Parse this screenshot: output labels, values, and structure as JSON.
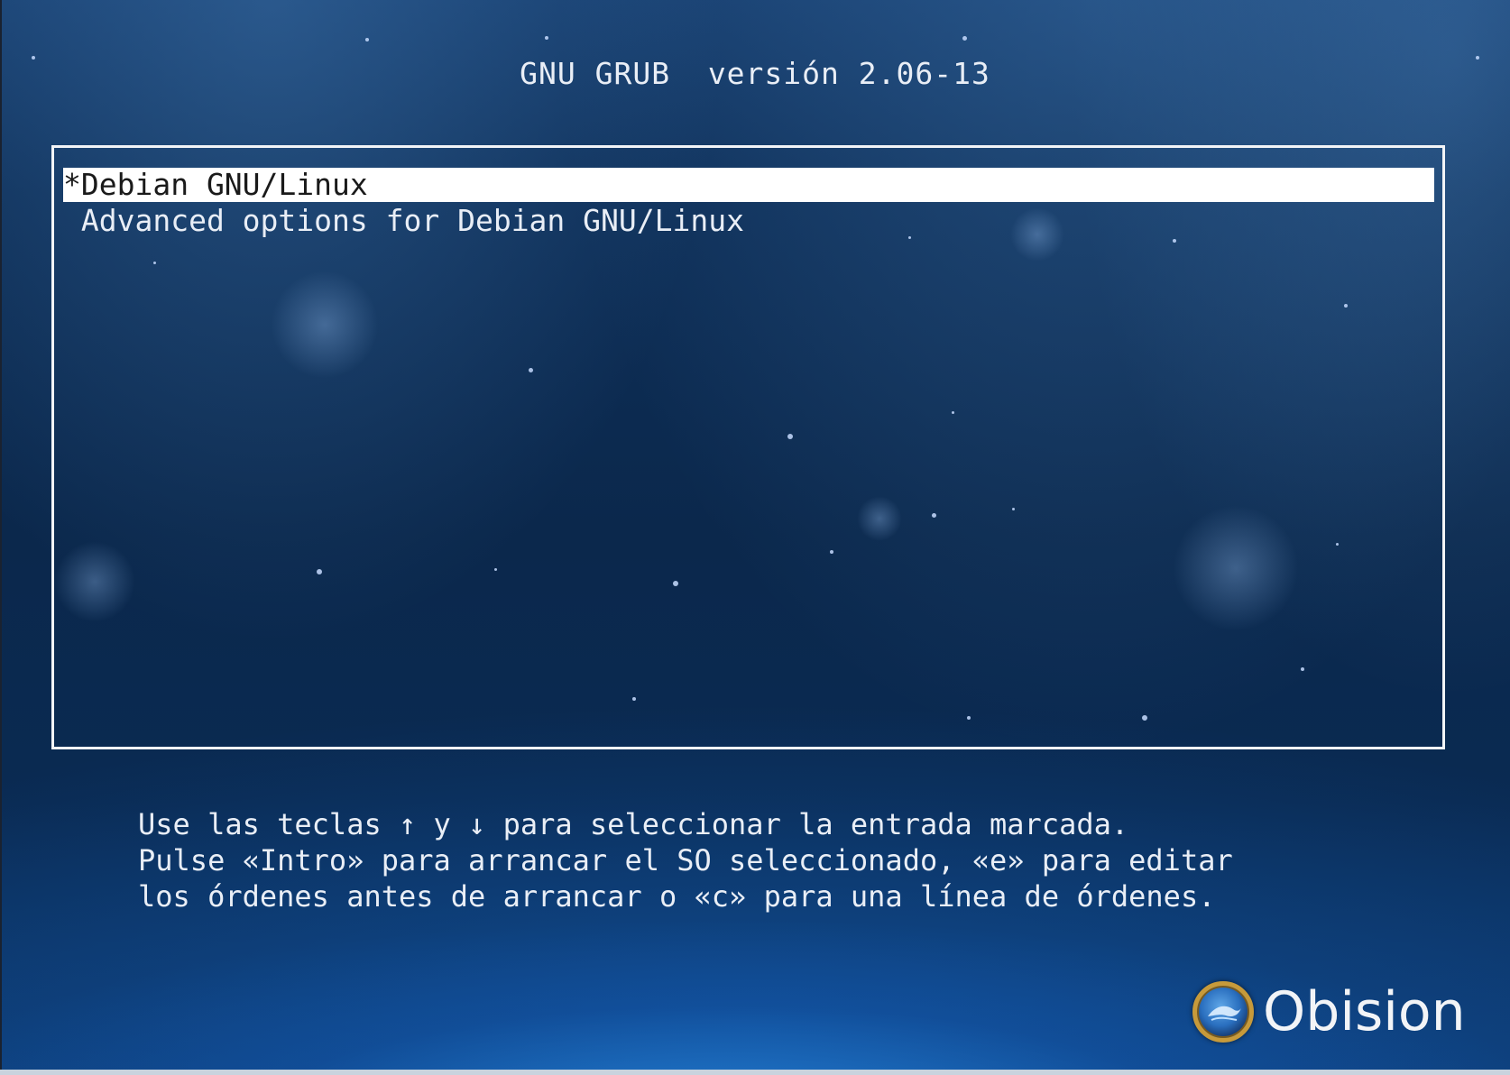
{
  "header": {
    "title": "GNU GRUB  versión 2.06-13"
  },
  "menu": {
    "entries": [
      {
        "label": "*Debian GNU/Linux",
        "selected": true
      },
      {
        "label": " Advanced options for Debian GNU/Linux",
        "selected": false
      }
    ]
  },
  "help": {
    "line1": "Use las teclas ↑ y ↓ para seleccionar la entrada marcada.",
    "line2": "Pulse «Intro» para arrancar el SO seleccionado, «e» para editar",
    "line3": "los órdenes antes de arrancar o «c» para una línea de órdenes."
  },
  "branding": {
    "logo_text": "Obision",
    "logo_icon": "obision-logo-icon"
  },
  "colors": {
    "background": "#0b2a4e",
    "text": "#e9eef6",
    "highlight": "#ffffff",
    "highlight_text": "#1a1a1a"
  }
}
